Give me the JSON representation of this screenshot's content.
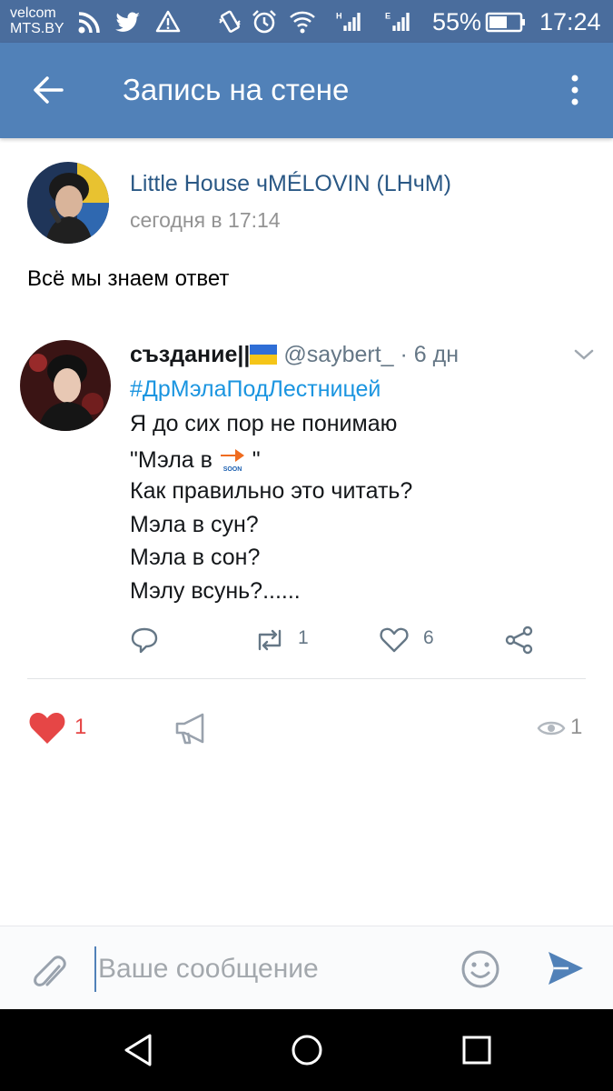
{
  "status_bar": {
    "carrier_line1": "velcom",
    "carrier_line2": "MTS.BY",
    "battery_percent": "55%",
    "time": "17:24"
  },
  "toolbar": {
    "title": "Запись на стене"
  },
  "post": {
    "author_name": "Little House чMÉLOVIN (LHчM)",
    "time": "сегодня в 17:14",
    "text": "Всё мы знаем ответ"
  },
  "tweet": {
    "user_name": "създание||",
    "handle_time": " @saybert_ · 6 дн",
    "hashtag": "#ДрМэлаПодЛестницей",
    "line1": "Я до сих пор не понимаю",
    "line2_before": "\"Мэла в ",
    "line2_after": " \"",
    "emoji_text": "SOON",
    "line3": "Как правильно это читать?",
    "line4": "Мэла в сун?",
    "line5": "Мэла в сон?",
    "line6": "Мэлу всунь?......",
    "retweet_count": "1",
    "like_count": "6"
  },
  "footer": {
    "like_count": "1",
    "views_count": "1"
  },
  "composer": {
    "placeholder": "Ваше сообщение"
  },
  "colors": {
    "status_bar": "#4a6d9d",
    "toolbar": "#5181b8",
    "link": "#2a5885",
    "hashtag": "#1b95e0",
    "like": "#e64646"
  }
}
